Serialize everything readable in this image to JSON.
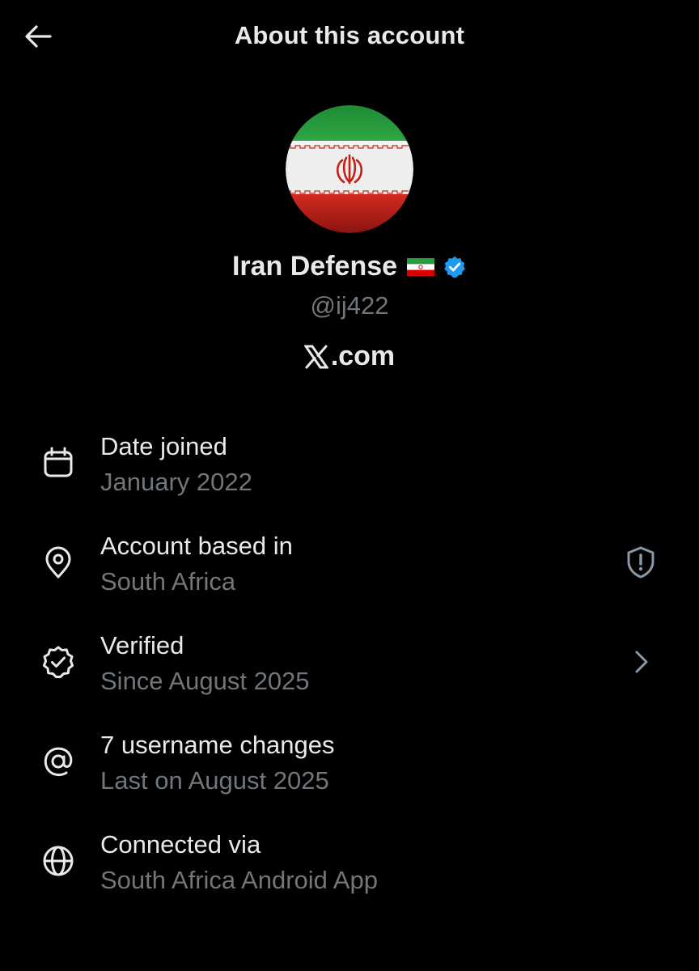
{
  "header": {
    "title": "About this account",
    "back_icon": "arrow-left-icon"
  },
  "profile": {
    "avatar_description_icon": "iran-flag-avatar",
    "display_name": "Iran Defense",
    "flag_emoji_icon": "iran-flag-emoji",
    "verified_icon": "verified-badge-icon",
    "verified_color": "#1d9bf0",
    "handle": "@ij422",
    "site_label": ".com",
    "site_icon": "x-logo-icon"
  },
  "info": [
    {
      "icon": "calendar-icon",
      "title": "Date joined",
      "value": "January 2022"
    },
    {
      "icon": "location-pin-icon",
      "title": "Account based in",
      "value": "South Africa",
      "right_icon": "shield-alert-icon"
    },
    {
      "icon": "verified-outline-icon",
      "title": "Verified",
      "value": "Since August 2025",
      "right_icon": "chevron-right-icon"
    },
    {
      "icon": "at-sign-icon",
      "title": "7 username changes",
      "value": "Last on August 2025"
    },
    {
      "icon": "globe-icon",
      "title": "Connected via",
      "value": "South Africa Android App"
    }
  ],
  "colors": {
    "background": "#000000",
    "primary_text": "#e7e9ea",
    "secondary_text": "#71767b",
    "flag_green": "#239f40",
    "flag_white": "#ffffff",
    "flag_red": "#da0000"
  }
}
